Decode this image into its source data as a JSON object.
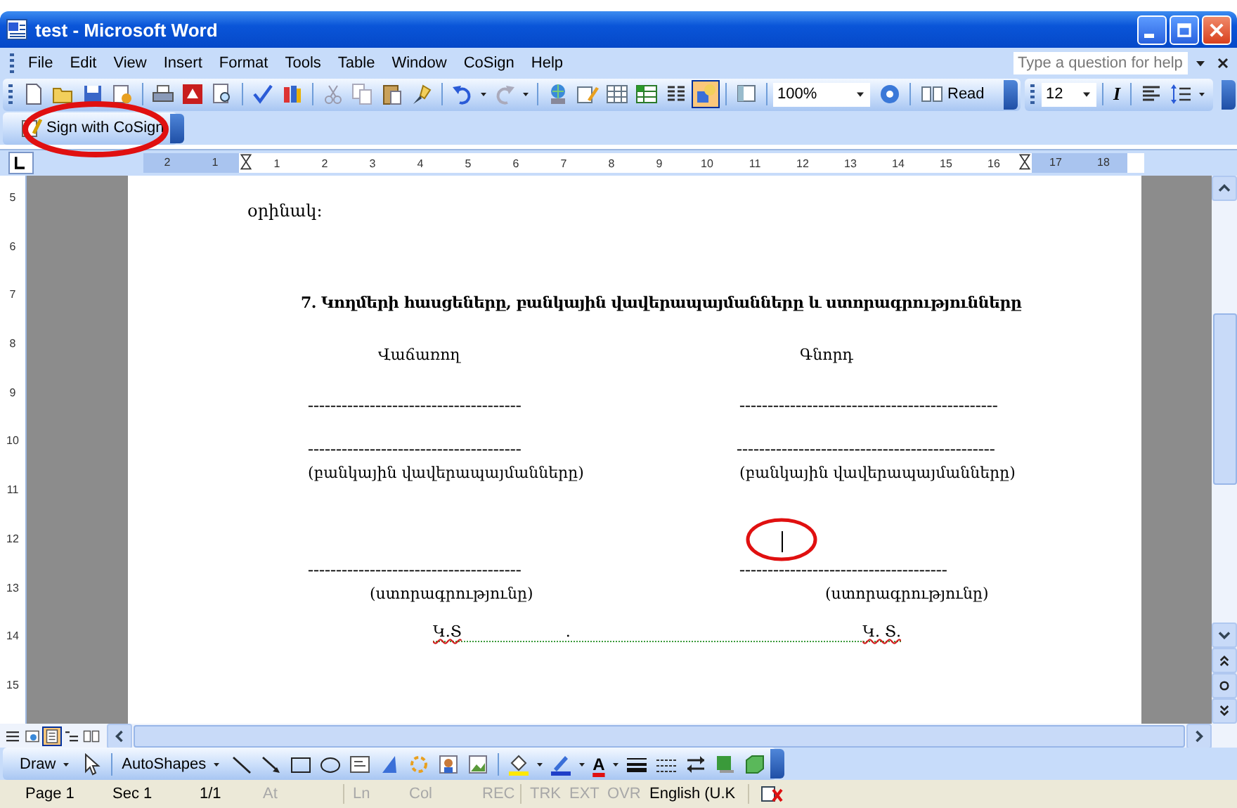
{
  "window": {
    "title": "test - Microsoft Word"
  },
  "menu": [
    "File",
    "Edit",
    "View",
    "Insert",
    "Format",
    "Tools",
    "Table",
    "Window",
    "CoSign",
    "Help"
  ],
  "help_box": {
    "placeholder": "Type a question for help"
  },
  "standard_toolbar": {
    "zoom": "100%",
    "read": "Read"
  },
  "formatting_toolbar": {
    "font_size": "12",
    "italic": "I"
  },
  "cosign_toolbar": {
    "button": "Sign with CoSign"
  },
  "ruler": {
    "marks": [
      {
        "kind": "number",
        "label": "2",
        "margin": true
      },
      {
        "kind": "number",
        "label": "1",
        "margin": true
      },
      {
        "kind": "indent"
      },
      {
        "kind": "number",
        "label": "1",
        "margin": false
      },
      {
        "kind": "number",
        "label": "2",
        "margin": false
      },
      {
        "kind": "number",
        "label": "3",
        "margin": false
      },
      {
        "kind": "number",
        "label": "4",
        "margin": false
      },
      {
        "kind": "number",
        "label": "5",
        "margin": false
      },
      {
        "kind": "number",
        "label": "6",
        "margin": false
      },
      {
        "kind": "number",
        "label": "7",
        "margin": false
      },
      {
        "kind": "number",
        "label": "8",
        "margin": false
      },
      {
        "kind": "number",
        "label": "9",
        "margin": false
      },
      {
        "kind": "number",
        "label": "10",
        "margin": false
      },
      {
        "kind": "number",
        "label": "11",
        "margin": false
      },
      {
        "kind": "number",
        "label": "12",
        "margin": false
      },
      {
        "kind": "number",
        "label": "13",
        "margin": false
      },
      {
        "kind": "number",
        "label": "14",
        "margin": false
      },
      {
        "kind": "number",
        "label": "15",
        "margin": false
      },
      {
        "kind": "number",
        "label": "16",
        "margin": false
      },
      {
        "kind": "indent"
      },
      {
        "kind": "number",
        "label": "17",
        "margin": true
      },
      {
        "kind": "number",
        "label": "18",
        "margin": true
      }
    ]
  },
  "vertical_ruler": [
    "5",
    "6",
    "7",
    "8",
    "9",
    "10",
    "11",
    "12",
    "13",
    "14",
    "15"
  ],
  "document": {
    "intro": "օրինակ:",
    "heading": "7. Կողմերի հասցեները, բանկային վավերապայմանները և ստորագրությունները",
    "columns": [
      {
        "party": "Վաճառող",
        "line_1": "--------------------------------------",
        "line_2": "--------------------------------------",
        "bank": "(բանկային վավերապայմանները)",
        "line_3": "--------------------------------------",
        "signature": "(ստորագրությունը)",
        "seal": "Կ.Տ"
      },
      {
        "party": "Գնորդ",
        "line_1": "----------------------------------------------",
        "line_2": "----------------------------------------------",
        "bank": "(բանկային վավերապայմանները)",
        "line_3": "-------------------------------------",
        "signature": "(ստորագրությունը)",
        "seal": "Կ. Տ."
      }
    ],
    "seal_separator": "."
  },
  "view_buttons": [
    {
      "kind": "normal",
      "selected": false
    },
    {
      "kind": "web",
      "selected": false
    },
    {
      "kind": "print",
      "selected": true
    },
    {
      "kind": "outline",
      "selected": false
    },
    {
      "kind": "reading",
      "selected": false
    }
  ],
  "drawing_toolbar": {
    "draw": "Draw",
    "autoshapes": "AutoShapes",
    "font_color": "A"
  },
  "status_bar": [
    {
      "label": "Page 1",
      "disabled": false
    },
    {
      "label": "Sec 1",
      "disabled": false
    },
    {
      "label": "1/1",
      "disabled": false
    },
    {
      "label": "At",
      "disabled": true
    },
    {
      "label": "Ln",
      "disabled": true
    },
    {
      "label": "Col",
      "disabled": true
    },
    {
      "label": "REC",
      "disabled": true
    },
    {
      "label": "TRK",
      "disabled": true
    },
    {
      "label": "EXT",
      "disabled": true
    },
    {
      "label": "OVR",
      "disabled": true
    },
    {
      "label": "English (U.K",
      "disabled": false
    }
  ]
}
